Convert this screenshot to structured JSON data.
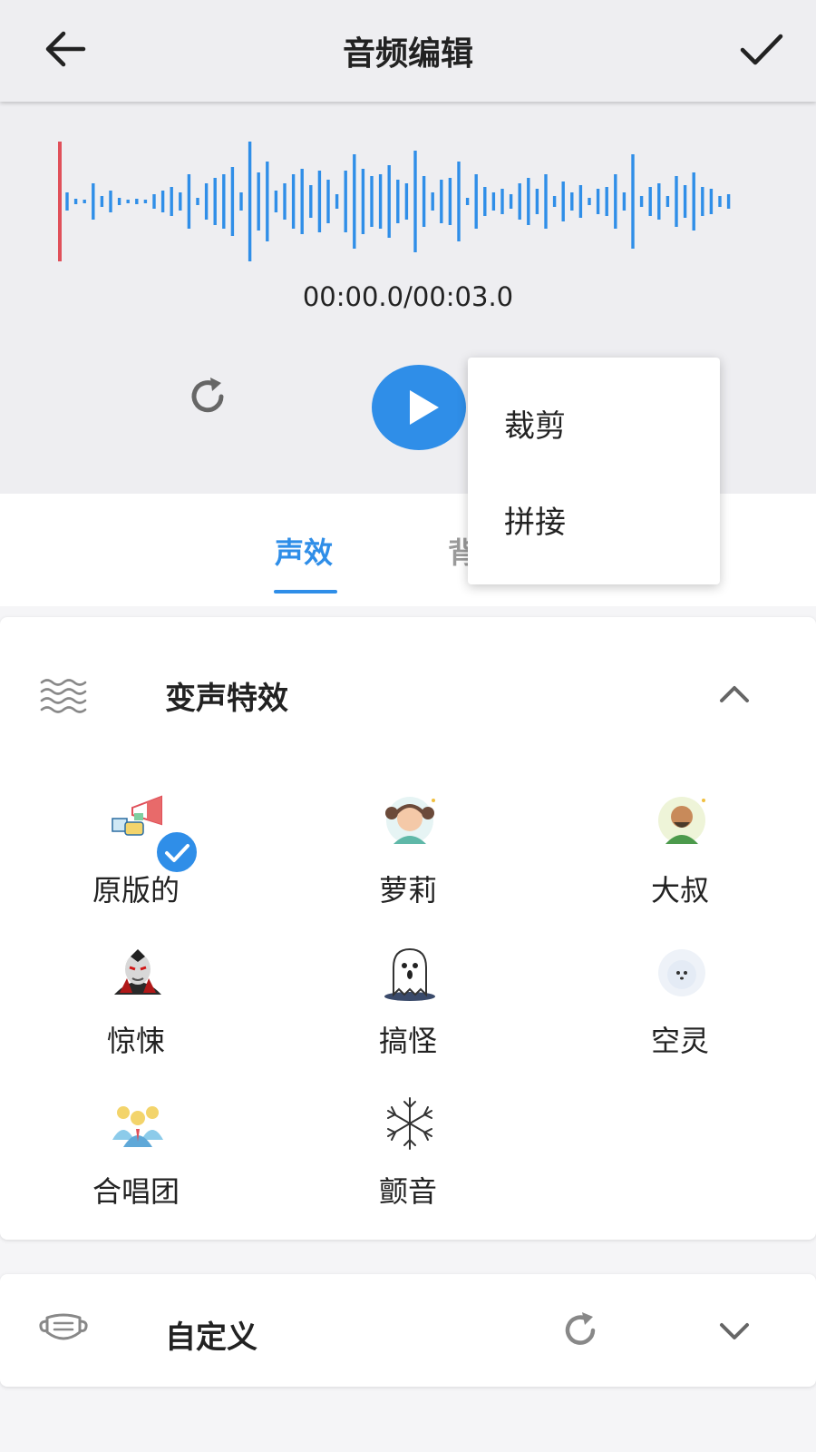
{
  "header": {
    "title": "音频编辑",
    "back_icon": "arrow-left-icon",
    "confirm_icon": "check-icon"
  },
  "player": {
    "time_display": "00:00.0/00:03.0",
    "accent_color": "#2f8ee8",
    "playhead_color": "#e0505a"
  },
  "tabs": [
    {
      "label": "声效",
      "active": true
    },
    {
      "label": "背景音乐",
      "active": false
    }
  ],
  "popup_menu": {
    "items": [
      "裁剪",
      "拼接"
    ]
  },
  "effects_section": {
    "title": "变声特效",
    "icon": "waves-icon",
    "expanded": true,
    "items": [
      {
        "label": "原版的",
        "icon": "megaphone-icon",
        "selected": true
      },
      {
        "label": "萝莉",
        "icon": "girl-avatar-icon",
        "selected": false
      },
      {
        "label": "大叔",
        "icon": "uncle-avatar-icon",
        "selected": false
      },
      {
        "label": "惊悚",
        "icon": "vampire-icon",
        "selected": false
      },
      {
        "label": "搞怪",
        "icon": "ghost-icon",
        "selected": false
      },
      {
        "label": "空灵",
        "icon": "spirit-icon",
        "selected": false
      },
      {
        "label": "合唱团",
        "icon": "choir-icon",
        "selected": false
      },
      {
        "label": "颤音",
        "icon": "snowflake-icon",
        "selected": false
      }
    ]
  },
  "custom_section": {
    "title": "自定义",
    "icon": "mask-icon",
    "expanded": false
  }
}
